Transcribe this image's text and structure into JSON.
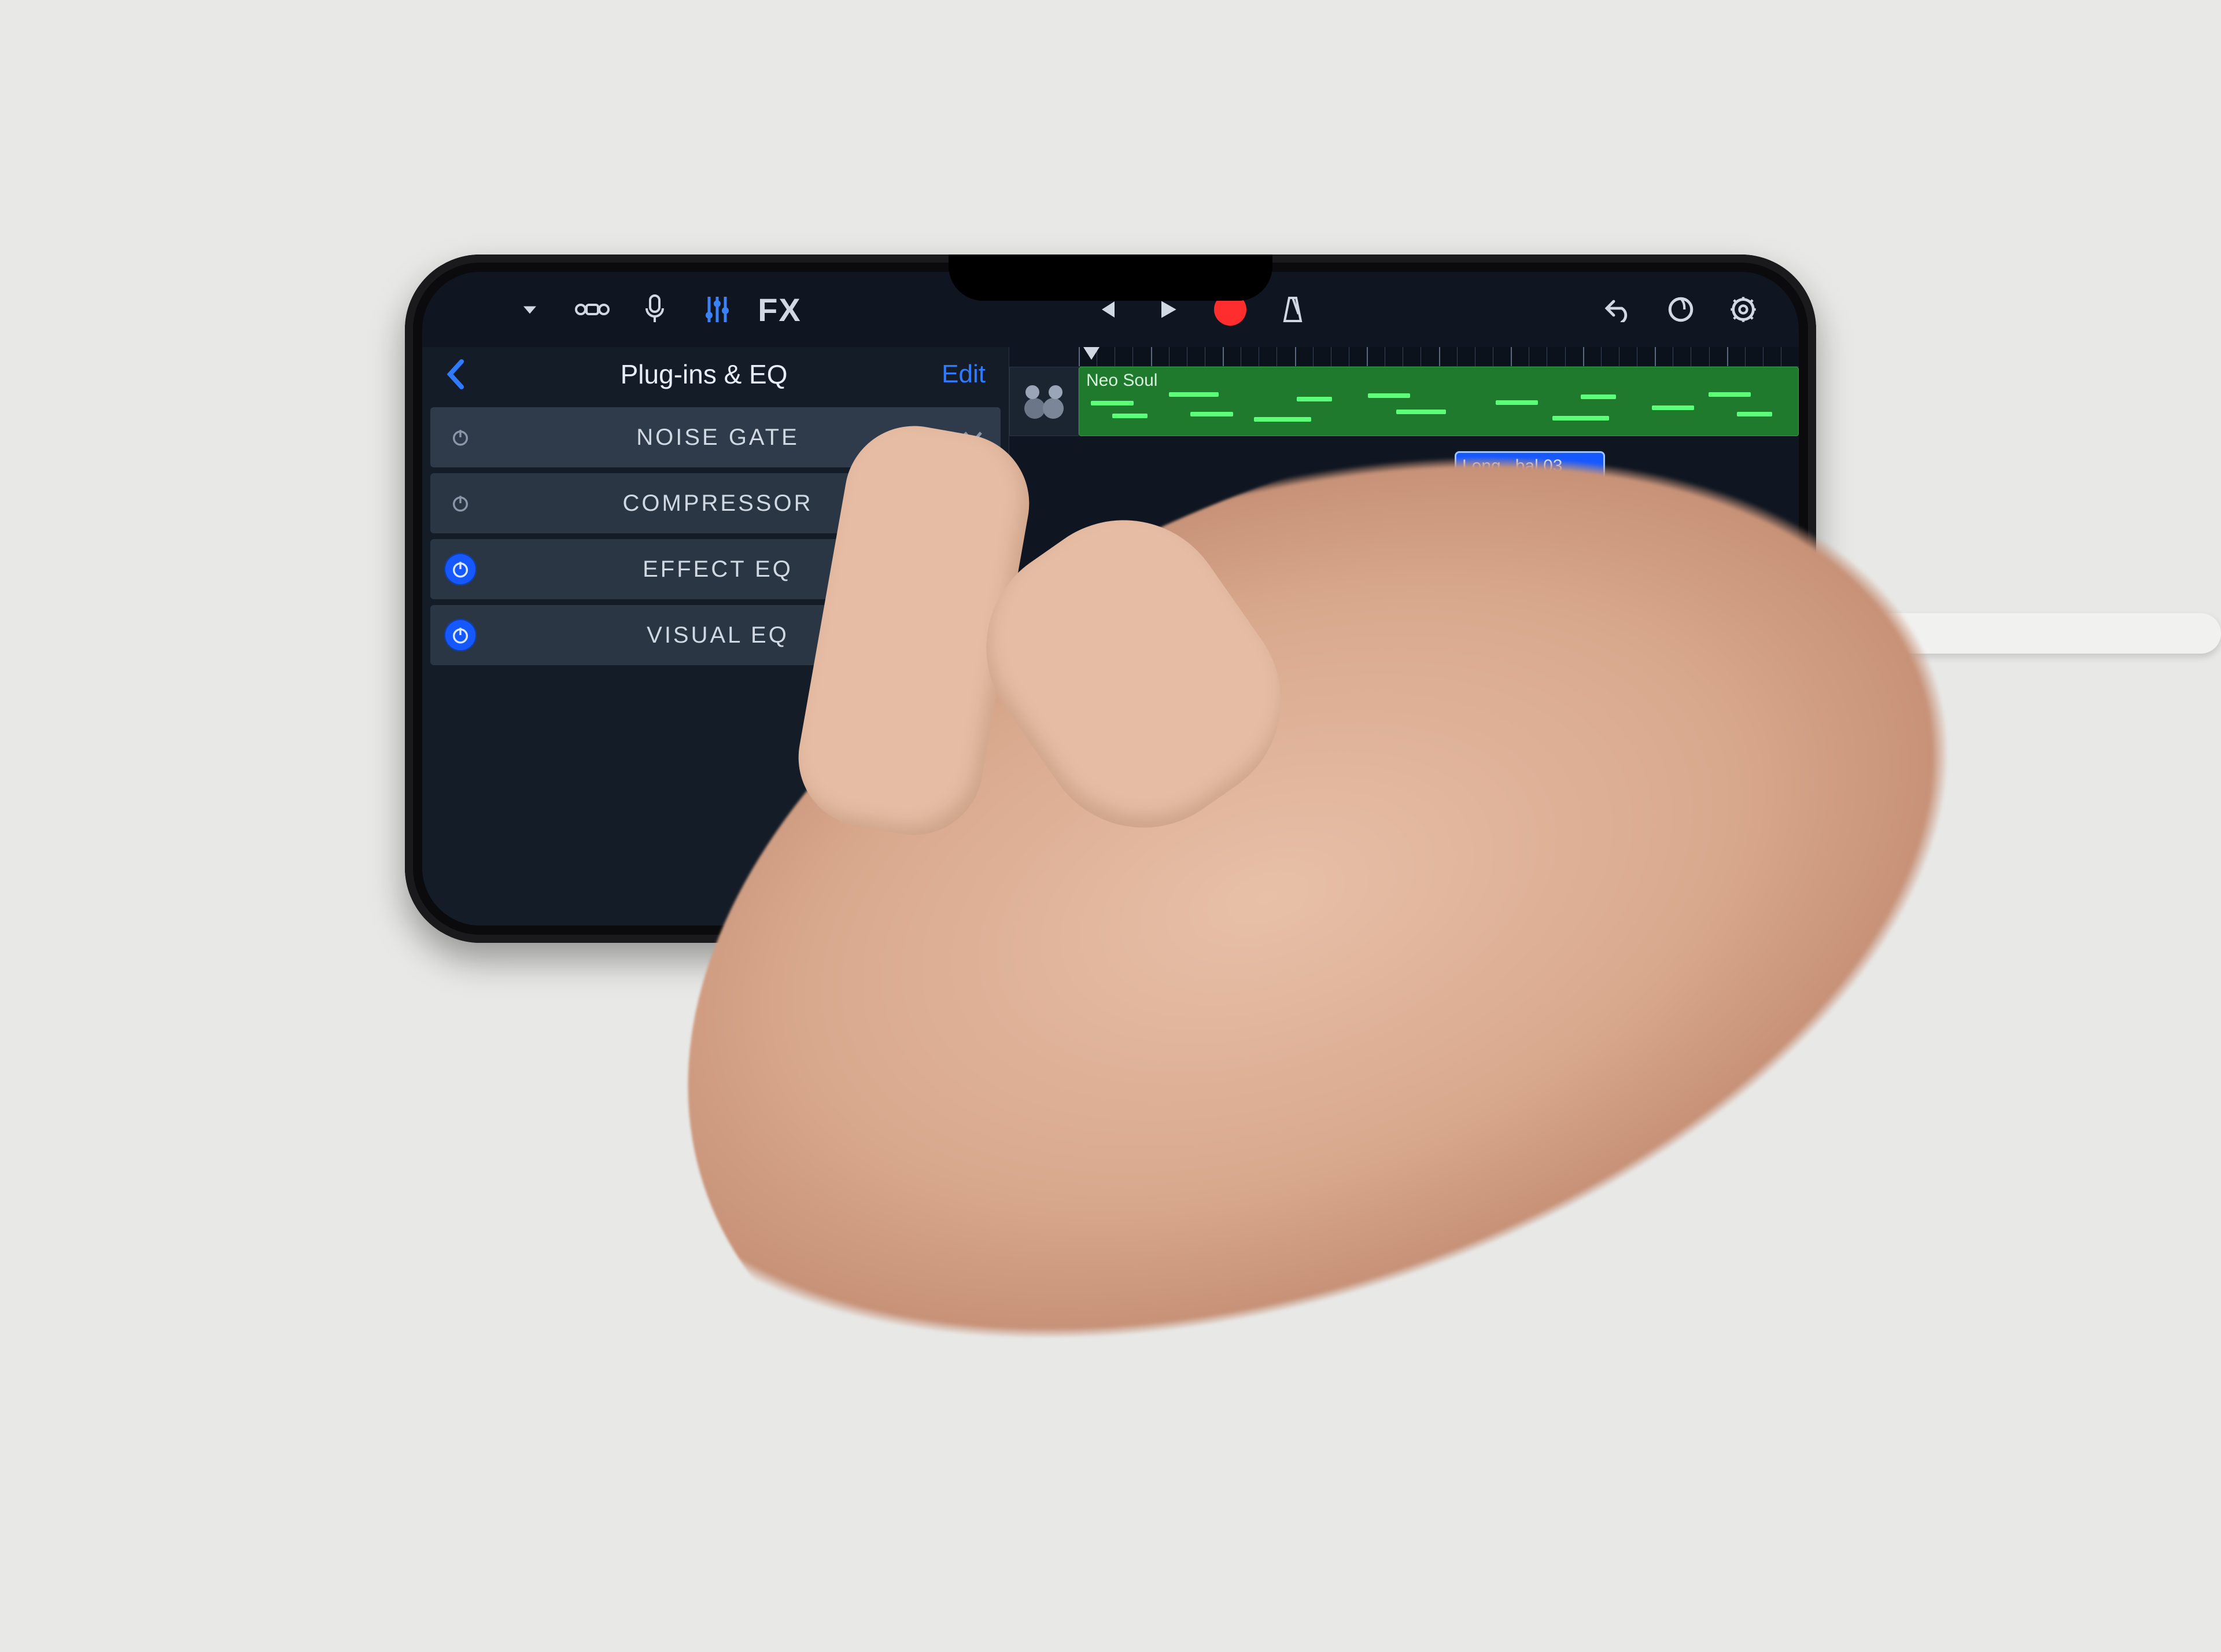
{
  "toolbar": {
    "fx_label": "FX"
  },
  "panel": {
    "title": "Plug-ins & EQ",
    "edit_label": "Edit",
    "items": [
      {
        "name": "NOISE GATE",
        "on": false,
        "chevron": true
      },
      {
        "name": "COMPRESSOR",
        "on": false,
        "chevron": false
      },
      {
        "name": "EFFECT EQ",
        "on": true,
        "chevron": false
      },
      {
        "name": "VISUAL EQ",
        "on": true,
        "chevron": false
      }
    ]
  },
  "timeline": {
    "track1_name": "Neo Soul",
    "clip_name": "Long...bal 03",
    "add_label": "+"
  },
  "colors": {
    "accent_blue": "#1558ff",
    "record_red": "#ff2d2d",
    "region_green": "#1f7a2e"
  }
}
